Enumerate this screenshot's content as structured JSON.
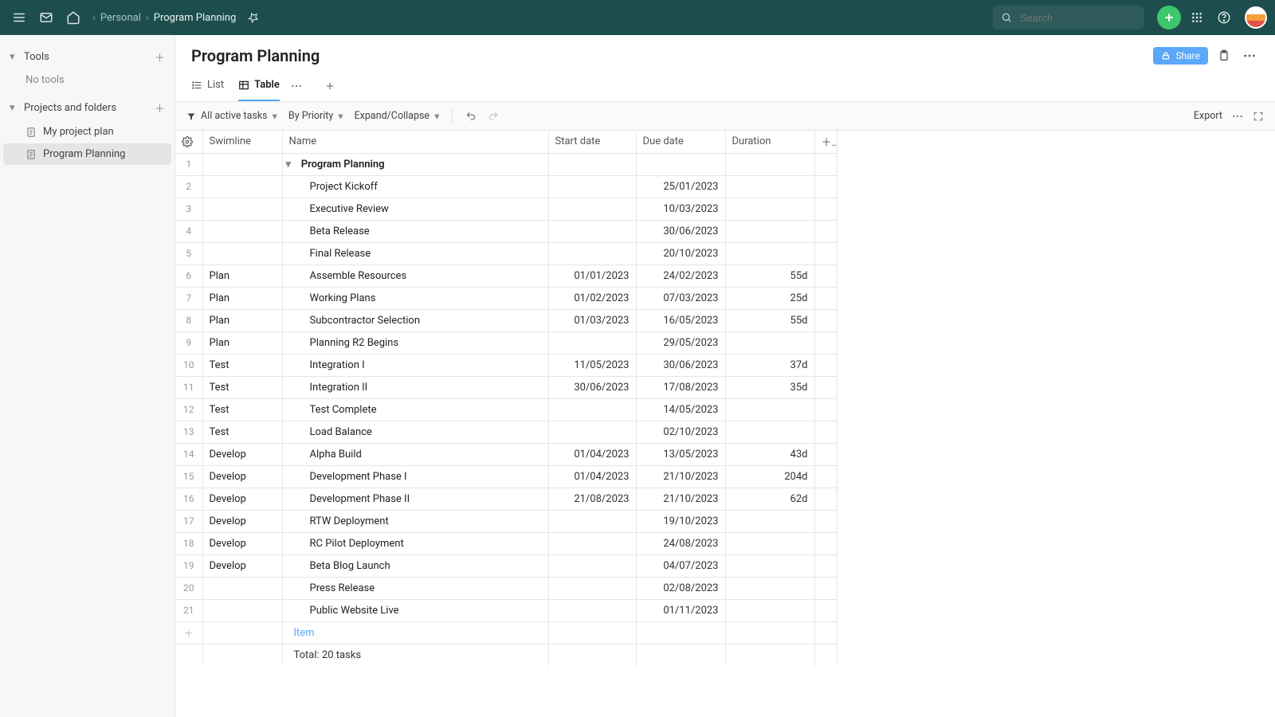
{
  "breadcrumb": {
    "root": "Personal",
    "current": "Program Planning"
  },
  "search": {
    "placeholder": "Search"
  },
  "sidebar": {
    "sections": [
      {
        "label": "Tools",
        "empty_text": "No tools"
      },
      {
        "label": "Projects and folders"
      }
    ],
    "items": [
      {
        "label": "My project plan",
        "active": false
      },
      {
        "label": "Program Planning",
        "active": true
      }
    ]
  },
  "page": {
    "title": "Program Planning",
    "share_label": "Share"
  },
  "view_tabs": {
    "list": "List",
    "table": "Table"
  },
  "toolbar": {
    "filter": "All active tasks",
    "group": "By Priority",
    "expand": "Expand/Collapse",
    "export": "Export"
  },
  "columns": {
    "swimline": "Swimline",
    "name": "Name",
    "start": "Start date",
    "due": "Due date",
    "duration": "Duration"
  },
  "group_name": "Program Planning",
  "rows": [
    {
      "n": 2,
      "swim": "",
      "name": "Project Kickoff",
      "start": "",
      "due": "25/01/2023",
      "dur": "",
      "child": true
    },
    {
      "n": 3,
      "swim": "",
      "name": "Executive Review",
      "start": "",
      "due": "10/03/2023",
      "dur": "",
      "child": true
    },
    {
      "n": 4,
      "swim": "",
      "name": "Beta Release",
      "start": "",
      "due": "30/06/2023",
      "dur": "",
      "child": true
    },
    {
      "n": 5,
      "swim": "",
      "name": "Final Release",
      "start": "",
      "due": "20/10/2023",
      "dur": "",
      "child": true
    },
    {
      "n": 6,
      "swim": "Plan",
      "name": "Assemble Resources",
      "start": "01/01/2023",
      "due": "24/02/2023",
      "dur": "55d",
      "child": true
    },
    {
      "n": 7,
      "swim": "Plan",
      "name": "Working Plans",
      "start": "01/02/2023",
      "due": "07/03/2023",
      "dur": "25d",
      "child": true
    },
    {
      "n": 8,
      "swim": "Plan",
      "name": "Subcontractor Selection",
      "start": "01/03/2023",
      "due": "16/05/2023",
      "dur": "55d",
      "child": true
    },
    {
      "n": 9,
      "swim": "Plan",
      "name": "Planning R2 Begins",
      "start": "",
      "due": "29/05/2023",
      "dur": "",
      "child": true
    },
    {
      "n": 10,
      "swim": "Test",
      "name": "Integration I",
      "start": "11/05/2023",
      "due": "30/06/2023",
      "dur": "37d",
      "child": true
    },
    {
      "n": 11,
      "swim": "Test",
      "name": "Integration II",
      "start": "30/06/2023",
      "due": "17/08/2023",
      "dur": "35d",
      "child": true
    },
    {
      "n": 12,
      "swim": "Test",
      "name": "Test Complete",
      "start": "",
      "due": "14/05/2023",
      "dur": "",
      "child": true
    },
    {
      "n": 13,
      "swim": "Test",
      "name": "Load Balance",
      "start": "",
      "due": "02/10/2023",
      "dur": "",
      "child": true
    },
    {
      "n": 14,
      "swim": "Develop",
      "name": "Alpha Build",
      "start": "01/04/2023",
      "due": "13/05/2023",
      "dur": "43d",
      "child": true
    },
    {
      "n": 15,
      "swim": "Develop",
      "name": "Development Phase I",
      "start": "01/04/2023",
      "due": "21/10/2023",
      "dur": "204d",
      "child": true
    },
    {
      "n": 16,
      "swim": "Develop",
      "name": "Development Phase II",
      "start": "21/08/2023",
      "due": "21/10/2023",
      "dur": "62d",
      "child": true
    },
    {
      "n": 17,
      "swim": "Develop",
      "name": "RTW Deployment",
      "start": "",
      "due": "19/10/2023",
      "dur": "",
      "child": true
    },
    {
      "n": 18,
      "swim": "Develop",
      "name": "RC Pilot Deployment",
      "start": "",
      "due": "24/08/2023",
      "dur": "",
      "child": true
    },
    {
      "n": 19,
      "swim": "Develop",
      "name": "Beta Blog Launch",
      "start": "",
      "due": "04/07/2023",
      "dur": "",
      "child": true
    },
    {
      "n": 20,
      "swim": "",
      "name": "Press Release",
      "start": "",
      "due": "02/08/2023",
      "dur": "",
      "child": true
    },
    {
      "n": 21,
      "swim": "",
      "name": "Public Website Live",
      "start": "",
      "due": "01/11/2023",
      "dur": "",
      "child": true
    }
  ],
  "add_item_text": "Item",
  "footer": {
    "total": "Total: 20 tasks"
  }
}
